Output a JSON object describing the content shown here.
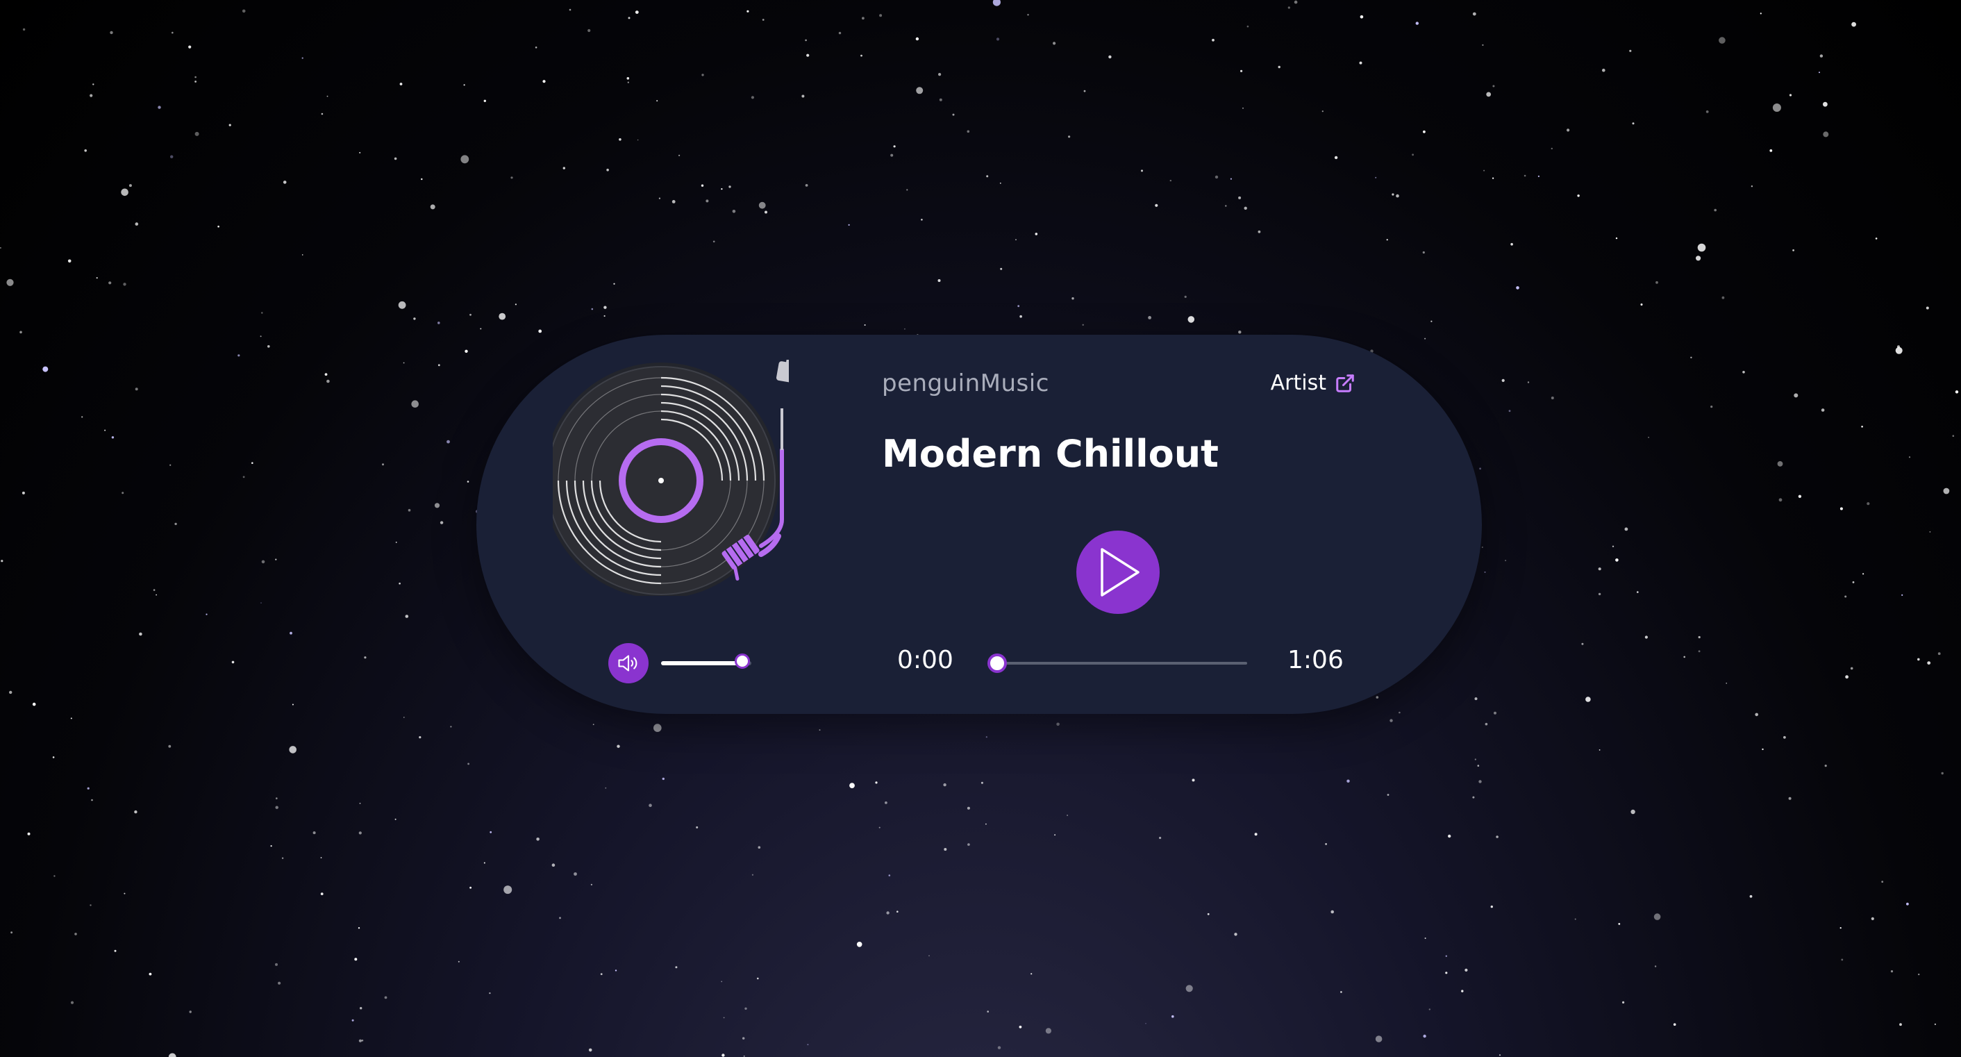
{
  "player": {
    "brand": "penguinMusic",
    "title": "Modern Chillout",
    "artist_link_label": "Artist",
    "current_time": "0:00",
    "total_time": "1:06",
    "progress": 0,
    "volume": 0.9,
    "is_playing": false
  },
  "icons": {
    "play": "play-icon",
    "volume": "volume-icon",
    "external_link": "external-link-icon",
    "turntable": "vinyl-turntable-icon"
  },
  "colors": {
    "accent": "#8a34cf",
    "card": "#1a2036",
    "text_primary": "#ffffff",
    "text_muted": "#a9adbb"
  }
}
